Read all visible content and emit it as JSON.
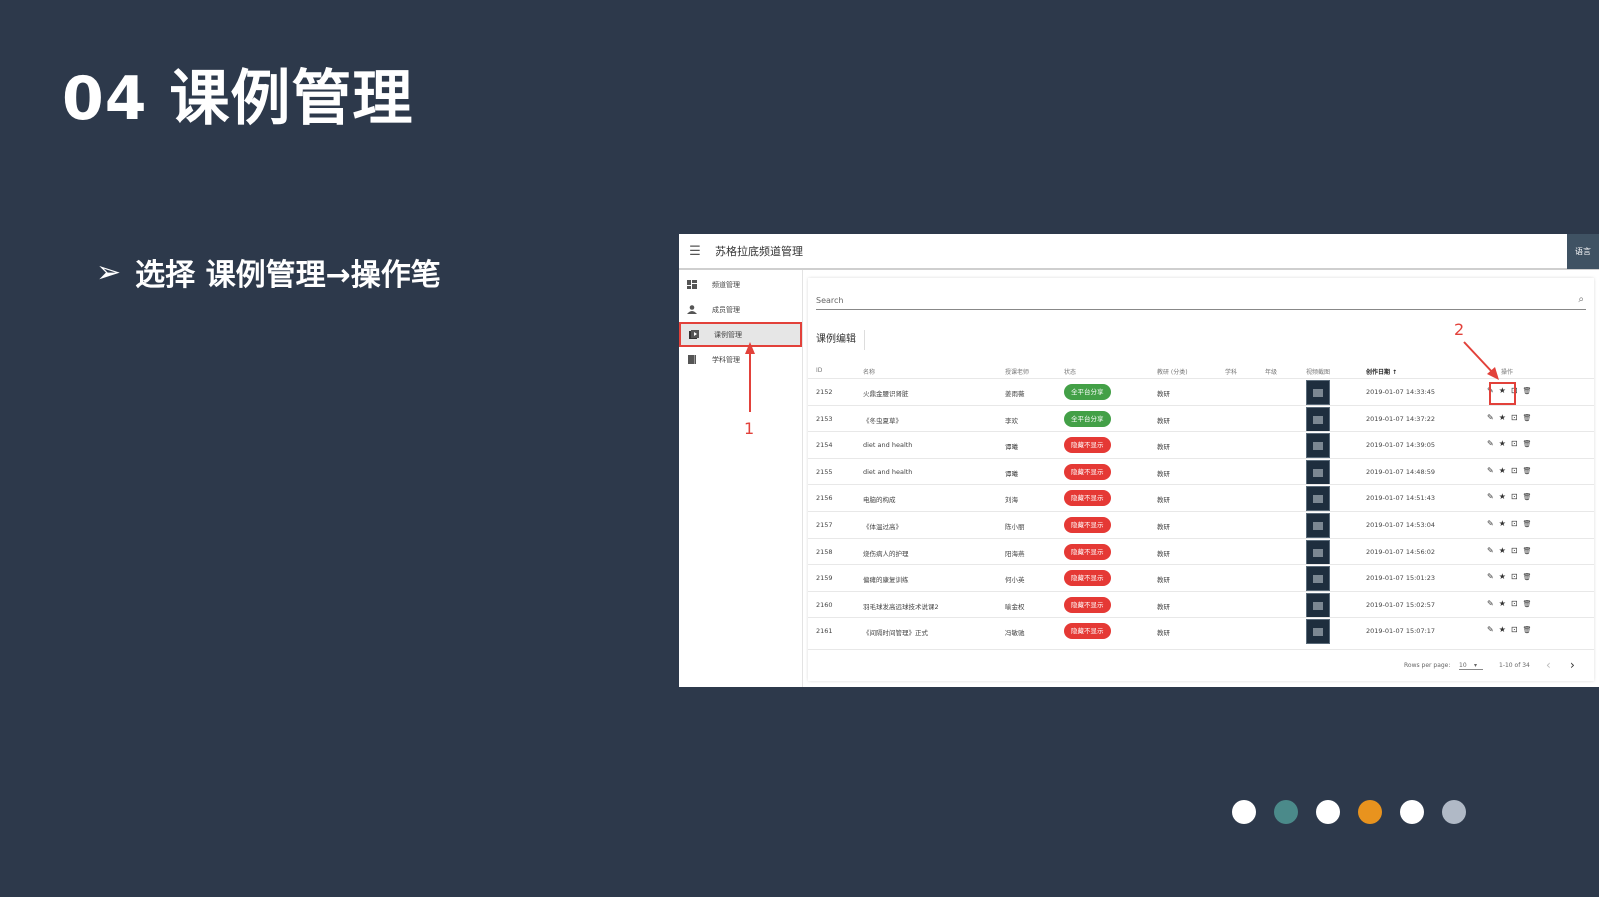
{
  "slide": {
    "title": "04 课例管理",
    "bullet": "选择 课例管理→操作笔"
  },
  "app": {
    "title": "苏格拉底频道管理",
    "lang_button": "语言",
    "sidebar": [
      {
        "label": "频道管理",
        "icon": "dashboard-icon"
      },
      {
        "label": "成员管理",
        "icon": "person-icon"
      },
      {
        "label": "课例管理",
        "icon": "library-icon"
      },
      {
        "label": "学科管理",
        "icon": "book-icon"
      }
    ],
    "active_sidebar_index": 2,
    "search_placeholder": "Search",
    "card_title": "课例编辑",
    "columns": [
      "ID",
      "名称",
      "授课老师",
      "状态",
      "教研 (分类)",
      "学科",
      "年级",
      "视频截图",
      "创作日期 ↑",
      "操作"
    ],
    "rows": [
      {
        "id": "2152",
        "name": "火鼎金腰识肾脏",
        "teacher": "姜雨薇",
        "status": "全平台分享",
        "status_color": "#43a047",
        "category": "教研",
        "date": "2019-01-07 14:33:45"
      },
      {
        "id": "2153",
        "name": "《冬虫夏草》",
        "teacher": "李欢",
        "status": "全平台分享",
        "status_color": "#43a047",
        "category": "教研",
        "date": "2019-01-07 14:37:22"
      },
      {
        "id": "2154",
        "name": "diet and health",
        "teacher": "谭曦",
        "status": "隐藏不显示",
        "status_color": "#e53935",
        "category": "教研",
        "date": "2019-01-07 14:39:05"
      },
      {
        "id": "2155",
        "name": "diet and health",
        "teacher": "谭曦",
        "status": "隐藏不显示",
        "status_color": "#e53935",
        "category": "教研",
        "date": "2019-01-07 14:48:59"
      },
      {
        "id": "2156",
        "name": "电脑的构成",
        "teacher": "刘海",
        "status": "隐藏不显示",
        "status_color": "#e53935",
        "category": "教研",
        "date": "2019-01-07 14:51:43"
      },
      {
        "id": "2157",
        "name": "《体温过高》",
        "teacher": "陈小丽",
        "status": "隐藏不显示",
        "status_color": "#e53935",
        "category": "教研",
        "date": "2019-01-07 14:53:04"
      },
      {
        "id": "2158",
        "name": "烧伤病人的护理",
        "teacher": "阳海燕",
        "status": "隐藏不显示",
        "status_color": "#e53935",
        "category": "教研",
        "date": "2019-01-07 14:56:02"
      },
      {
        "id": "2159",
        "name": "偏瘫的康复训练",
        "teacher": "何小英",
        "status": "隐藏不显示",
        "status_color": "#e53935",
        "category": "教研",
        "date": "2019-01-07 15:01:23"
      },
      {
        "id": "2160",
        "name": "羽毛球发高远球技术说课2",
        "teacher": "喻金权",
        "status": "隐藏不显示",
        "status_color": "#e53935",
        "category": "教研",
        "date": "2019-01-07 15:02:57"
      },
      {
        "id": "2161",
        "name": "《间隔时间管理》正式",
        "teacher": "冯敏驰",
        "status": "隐藏不显示",
        "status_color": "#e53935",
        "category": "教研",
        "date": "2019-01-07 15:07:17"
      }
    ],
    "action_icons": [
      "✎",
      "★",
      "⊡",
      "🗑"
    ],
    "footer": {
      "rows_per_page_label": "Rows per page:",
      "rows_per_page_value": "10",
      "range": "1-10 of 34",
      "prev": "‹",
      "next": "›"
    }
  },
  "annotations": {
    "label_1": "1",
    "label_2": "2",
    "color": "#e2413a"
  },
  "pager_dots": [
    {
      "color": "#ffffff"
    },
    {
      "color": "#4b8a8a"
    },
    {
      "color": "#ffffff"
    },
    {
      "color": "#e8931e"
    },
    {
      "color": "#ffffff"
    },
    {
      "color": "#b0b9c6"
    }
  ]
}
